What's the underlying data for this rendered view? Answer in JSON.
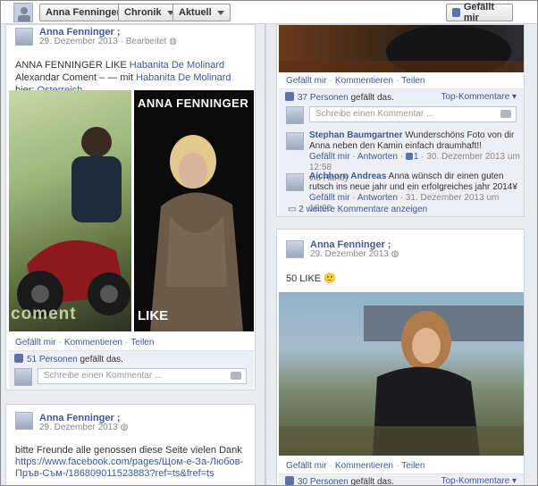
{
  "topbar": {
    "name_button": "Anna Fenninger ;",
    "chronik_button": "Chronik",
    "aktuell_button": "Aktuell",
    "like_button": "Gefällt mir"
  },
  "post1": {
    "author": "Anna Fenninger ;",
    "date": "29. Dezember 2013",
    "edited": "Bearbeitet",
    "text_pre": "ANNA FENNINGER LIKE",
    "link1": "Habanita De Molinard",
    "text_mid": "Alexandar Coment – — mit",
    "link2": "Habanita De Molinard",
    "text_hier": "hier:",
    "link3": "Osterreich.",
    "photo_left_caption": "coment",
    "photo_right_title": "ANNA FENNINGER",
    "photo_right_caption": "LIKE",
    "actions": [
      "Gefällt mir",
      "Kommentieren",
      "Teilen"
    ],
    "likes_link": "51 Personen",
    "likes_text": "gefällt das.",
    "comment_placeholder": "Schreibe einen Kommentar ..."
  },
  "post2": {
    "author": "Anna Fenninger ;",
    "date": "29. Dezember 2013",
    "text": "bitte Freunde alle genossen diese Seite vielen Dank",
    "url": "https://www.facebook.com/pages/Щом-е-За-Любов-Пръв-Съм-/186809011523883?ref=ts&fref=ts"
  },
  "right_top": {
    "actions": [
      "Gefällt mir",
      "Kommentieren",
      "Teilen"
    ],
    "likes_link": "37 Personen",
    "likes_text": "gefällt das.",
    "top_comments": "Top-Kommentare",
    "comment_placeholder": "Schreibe einen Kommentar ...",
    "comments": [
      {
        "name": "Stephan Baumgartner",
        "text": "Wunderschöns Foto von dir Anna neben den Kamin einfach draumhaft!!",
        "actions": [
          "Gefällt mir",
          "Antworten"
        ],
        "likes": "1",
        "time": "30. Dezember 2013 um 12:58",
        "via": "via Handy"
      },
      {
        "name": "Aichhorn Andreas",
        "text": "Anna wünsch dir einen guten rutsch ins neue jahr und ein erfolgreiches jahr 2014¥",
        "actions": [
          "Gefällt mir",
          "Antworten"
        ],
        "time": "31. Dezember 2013 um 16:00"
      }
    ],
    "more_comments": "2 weitere Kommentare anzeigen"
  },
  "post3": {
    "author": "Anna Fenninger ;",
    "date": "29. Dezember 2013",
    "text": "50 LIKE 🙂",
    "actions": [
      "Gefällt mir",
      "Kommentieren",
      "Teilen"
    ],
    "likes_link": "30 Personen",
    "likes_text": "gefällt das.",
    "top_comments": "Top-Kommentare"
  }
}
